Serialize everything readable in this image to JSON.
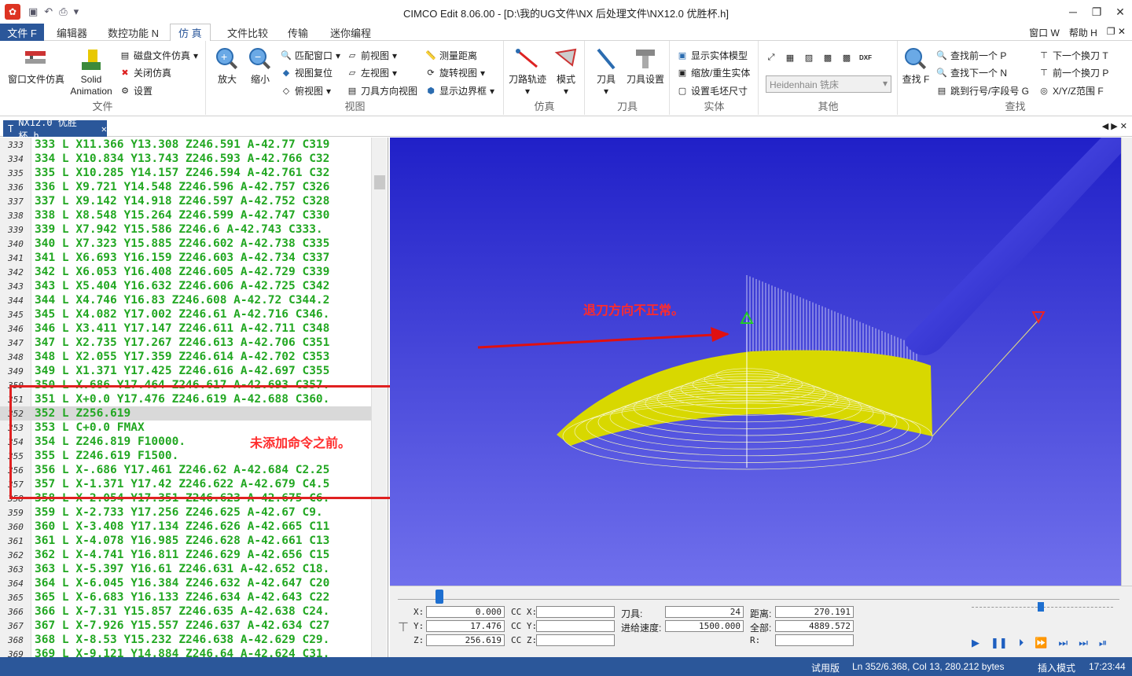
{
  "window": {
    "title": "CIMCO Edit 8.06.00 - [D:\\我的UG文件\\NX 后处理文件\\NX12.0 优胜杯.h]"
  },
  "menu": {
    "file": "文件 F",
    "tabs": [
      "编辑器",
      "数控功能 N",
      "仿 真",
      "文件比较",
      "传输",
      "迷你编程"
    ],
    "right": [
      "窗口 W",
      "帮助 H"
    ]
  },
  "ribbon": {
    "file_group": {
      "label": "文件",
      "window_sim": "窗口文件仿真",
      "solid_anim": "Solid Animation",
      "disk_sim": "磁盘文件仿真",
      "close_sim": "关闭仿真",
      "settings": "设置"
    },
    "view_group": {
      "label": "视图",
      "zoom_in": "放大",
      "zoom_out": "缩小",
      "fit": "匹配窗口",
      "reset": "视图复位",
      "top": "俯视图",
      "front": "前视图",
      "left": "左视图",
      "tool_dir": "刀具方向视图",
      "measure": "测量距离",
      "rotate": "旋转视图",
      "bounds": "显示边界框"
    },
    "sim_group": {
      "label": "仿真",
      "toolpath": "刀路轨迹",
      "mode": "模式"
    },
    "tool_group": {
      "label": "刀具",
      "tool": "刀具",
      "tool_setup": "刀具设置"
    },
    "solid_group": {
      "label": "实体",
      "show_model": "显示实体模型",
      "zoom_regen": "缩放/重生实体",
      "stock": "设置毛坯尺寸"
    },
    "other_group": {
      "label": "其他",
      "machine": "Heidenhain 铣床"
    },
    "find_group": {
      "label": "查找",
      "find": "查找 F",
      "prev": "查找前一个 P",
      "next": "查找下一个 N",
      "jump": "跳到行号/字段号 G",
      "next_tool": "下一个换刀 T",
      "prev_tool": "前一个换刀 P",
      "xyz": "X/Y/Z范围 F"
    }
  },
  "doc_tab": "NX12.0 优胜杯.h",
  "editor_lines": [
    {
      "n": "333",
      "code": "333 L X11.366 Y13.308 Z246.591 A-42.77 C319"
    },
    {
      "n": "334",
      "code": "334 L X10.834 Y13.743 Z246.593 A-42.766 C32"
    },
    {
      "n": "335",
      "code": "335 L X10.285 Y14.157 Z246.594 A-42.761 C32"
    },
    {
      "n": "336",
      "code": "336 L X9.721 Y14.548 Z246.596 A-42.757 C326"
    },
    {
      "n": "337",
      "code": "337 L X9.142 Y14.918 Z246.597 A-42.752 C328"
    },
    {
      "n": "338",
      "code": "338 L X8.548 Y15.264 Z246.599 A-42.747 C330"
    },
    {
      "n": "339",
      "code": "339 L X7.942 Y15.586 Z246.6 A-42.743 C333."
    },
    {
      "n": "340",
      "code": "340 L X7.323 Y15.885 Z246.602 A-42.738 C335"
    },
    {
      "n": "341",
      "code": "341 L X6.693 Y16.159 Z246.603 A-42.734 C337"
    },
    {
      "n": "342",
      "code": "342 L X6.053 Y16.408 Z246.605 A-42.729 C339"
    },
    {
      "n": "343",
      "code": "343 L X5.404 Y16.632 Z246.606 A-42.725 C342"
    },
    {
      "n": "344",
      "code": "344 L X4.746 Y16.83 Z246.608 A-42.72 C344.2"
    },
    {
      "n": "345",
      "code": "345 L X4.082 Y17.002 Z246.61 A-42.716 C346."
    },
    {
      "n": "346",
      "code": "346 L X3.411 Y17.147 Z246.611 A-42.711 C348"
    },
    {
      "n": "347",
      "code": "347 L X2.735 Y17.267 Z246.613 A-42.706 C351"
    },
    {
      "n": "348",
      "code": "348 L X2.055 Y17.359 Z246.614 A-42.702 C353"
    },
    {
      "n": "349",
      "code": "349 L X1.371 Y17.425 Z246.616 A-42.697 C355"
    },
    {
      "n": "350",
      "code": "350 L X.686 Y17.464 Z246.617 A-42.693 C357."
    },
    {
      "n": "351",
      "code": "351 L X+0.0 Y17.476 Z246.619 A-42.688 C360."
    },
    {
      "n": "352",
      "code": "352 L Z256.619"
    },
    {
      "n": "353",
      "code": "353 L C+0.0 FMAX"
    },
    {
      "n": "354",
      "code": "354 L Z246.819 F10000."
    },
    {
      "n": "355",
      "code": "355 L Z246.619 F1500."
    },
    {
      "n": "356",
      "code": "356 L X-.686 Y17.461 Z246.62 A-42.684 C2.25"
    },
    {
      "n": "357",
      "code": "357 L X-1.371 Y17.42 Z246.622 A-42.679 C4.5"
    },
    {
      "n": "358",
      "code": "358 L X-2.054 Y17.351 Z246.623 A-42.675 C6."
    },
    {
      "n": "359",
      "code": "359 L X-2.733 Y17.256 Z246.625 A-42.67 C9."
    },
    {
      "n": "360",
      "code": "360 L X-3.408 Y17.134 Z246.626 A-42.665 C11"
    },
    {
      "n": "361",
      "code": "361 L X-4.078 Y16.985 Z246.628 A-42.661 C13"
    },
    {
      "n": "362",
      "code": "362 L X-4.741 Y16.811 Z246.629 A-42.656 C15"
    },
    {
      "n": "363",
      "code": "363 L X-5.397 Y16.61 Z246.631 A-42.652 C18."
    },
    {
      "n": "364",
      "code": "364 L X-6.045 Y16.384 Z246.632 A-42.647 C20"
    },
    {
      "n": "365",
      "code": "365 L X-6.683 Y16.133 Z246.634 A-42.643 C22"
    },
    {
      "n": "366",
      "code": "366 L X-7.31 Y15.857 Z246.635 A-42.638 C24."
    },
    {
      "n": "367",
      "code": "367 L X-7.926 Y15.557 Z246.637 A-42.634 C27"
    },
    {
      "n": "368",
      "code": "368 L X-8.53 Y15.232 Z246.638 A-42.629 C29."
    },
    {
      "n": "369",
      "code": "369 L X-9.121 Y14.884 Z246.64 A-42.624 C31."
    }
  ],
  "annotations": {
    "retract": "退刀方向不正常。",
    "before": "未添加命令之前。"
  },
  "sim_panel": {
    "x_label": "X:",
    "x": "0.000",
    "y_label": "Y:",
    "y": "17.476",
    "z_label": "Z:",
    "z": "256.619",
    "ccx_label": "CC X:",
    "ccy_label": "CC Y:",
    "ccz_label": "CC Z:",
    "tool_label": "刀具:",
    "tool": "24",
    "feed_label": "进给速度:",
    "feed": "1500.000",
    "dist_label": "距离:",
    "dist": "270.191",
    "total_label": "全部:",
    "total": "4889.572",
    "r_label": "R:"
  },
  "status": {
    "trial": "试用版",
    "position": "Ln 352/6.368, Col 13, 280.212 bytes",
    "mode": "插入模式",
    "time": "17:23:44"
  }
}
